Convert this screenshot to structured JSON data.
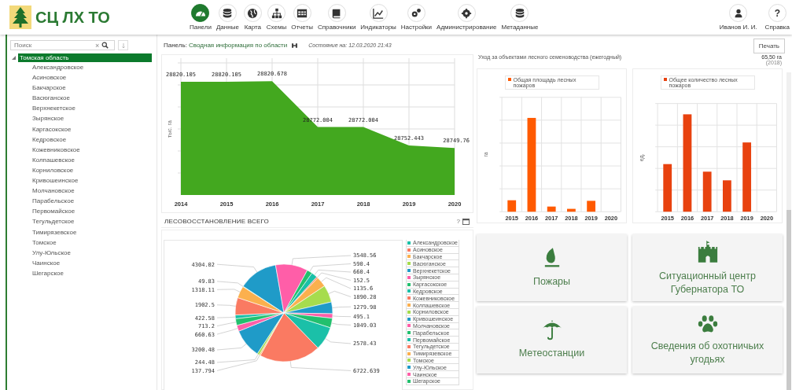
{
  "header": {
    "logo_text": "СЦ ЛХ ТО",
    "nav": [
      {
        "label": "Панели",
        "selected": true
      },
      {
        "label": "Данные",
        "selected": false
      },
      {
        "label": "Карта",
        "selected": false
      },
      {
        "label": "Схемы",
        "selected": false
      },
      {
        "label": "Отчеты",
        "selected": false
      },
      {
        "label": "Справочники",
        "selected": false
      },
      {
        "label": "Индикаторы",
        "selected": false
      },
      {
        "label": "Настройки",
        "selected": false
      },
      {
        "label": "Администрирование",
        "selected": false
      },
      {
        "label": "Метаданные",
        "selected": false
      }
    ],
    "user": {
      "name": "Иванов И. И."
    },
    "help": {
      "symbol": "?",
      "label": "Справка"
    }
  },
  "sidebar": {
    "search": {
      "placeholder": "Поиск",
      "clear_symbol": "×"
    },
    "tree": [
      {
        "label": "Томская область",
        "selected": true,
        "expanded": true,
        "children": [
          {
            "label": "Александровское",
            "selected": false
          },
          {
            "label": "Асиновское",
            "selected": false
          },
          {
            "label": "Бакчарское",
            "selected": false
          },
          {
            "label": "Васюганское",
            "selected": false
          },
          {
            "label": "Верхнекетское",
            "selected": false
          },
          {
            "label": "Зырянское",
            "selected": false
          },
          {
            "label": "Каргасокское",
            "selected": false
          },
          {
            "label": "Кедровское",
            "selected": false
          },
          {
            "label": "Кожевниковское",
            "selected": false
          },
          {
            "label": "Колпашевское",
            "selected": false
          },
          {
            "label": "Корниловское",
            "selected": false
          },
          {
            "label": "Кривошеинское",
            "selected": false
          },
          {
            "label": "Молчановское",
            "selected": false
          },
          {
            "label": "Парабельское",
            "selected": false
          },
          {
            "label": "Первомайское",
            "selected": false
          },
          {
            "label": "Тегульдетское",
            "selected": false
          },
          {
            "label": "Тимирязевское",
            "selected": false
          },
          {
            "label": "Томское",
            "selected": false
          },
          {
            "label": "Улу-Юльское",
            "selected": false
          },
          {
            "label": "Чаинское",
            "selected": false
          },
          {
            "label": "Шегарское",
            "selected": false
          }
        ]
      }
    ]
  },
  "panel": {
    "prefix": "Панель:",
    "name": "Сводная информация по области",
    "status": "Состояние на: 12.03.2020 21:43"
  },
  "area_chart": {
    "chart_data": {
      "type": "area",
      "ylabel": "тыс. га",
      "categories": [
        "2014",
        "2015",
        "2016",
        "2017",
        "2018",
        "2019",
        "2020"
      ],
      "ylim": [
        28700,
        28840
      ],
      "data_labels": true,
      "grid": true,
      "series": [
        {
          "color": "#43a81f",
          "values": [
            28820.105,
            28820.105,
            28820.678,
            28772.004,
            28772.004,
            28752.443,
            28749.76
          ]
        }
      ]
    }
  },
  "reforestation": {
    "title": "ЛЕСОВОССТАНОВЛЕНИЕ ВСЕГО",
    "help_symbol": "?",
    "chart_data": {
      "type": "pie",
      "data_labels": true,
      "legend": "right",
      "categories": [
        "Александровское",
        "Асиновское",
        "Бакчарское",
        "Васюганское",
        "Верхнекетское",
        "Зырянское",
        "Каргасокское",
        "Кедровское",
        "Кожевниковское",
        "Колпашевское",
        "Корниловское",
        "Кривошеинское",
        "Молчановское",
        "Парабельское",
        "Первомайское",
        "Тегульдетское",
        "Тимирязевское",
        "Томское",
        "Улу-Юльское",
        "Чаинское",
        "Шегарское"
      ],
      "series": [
        {
          "values": [
            422.58,
            1902.5,
            1318.11,
            49.83,
            4304.02,
            3548.56,
            590.4,
            660.4,
            152.5,
            1135.6,
            1890.28,
            1279.98,
            495.1,
            1049.03,
            2578.43,
            6722.639,
            137.794,
            244.48,
            3200.48,
            660.63,
            713.2
          ]
        }
      ]
    }
  },
  "print_button": "Печать",
  "indicator": {
    "label": "Уход за объектами лесного семеноводства (ежегодный)",
    "value": "65,50 га",
    "year": "(2018)"
  },
  "bar_charts": [
    {
      "legend": "Общая площадь лесных пожаров",
      "ylabel": "га",
      "x_labels": [
        "2015",
        "2016",
        "2017",
        "2018",
        "2019",
        "2020"
      ]
    },
    {
      "legend": "Общее количество лесных пожаров",
      "ylabel": "ед.",
      "x_labels": [
        "2015",
        "2016",
        "2017",
        "2018",
        "2019",
        "2020"
      ]
    }
  ],
  "tiles": [
    {
      "label": "Пожары"
    },
    {
      "label": "Ситуационный центр Губернатора ТО"
    },
    {
      "label": "Метеостанции"
    },
    {
      "label": "Сведения об охотничьих угодьях"
    }
  ]
}
